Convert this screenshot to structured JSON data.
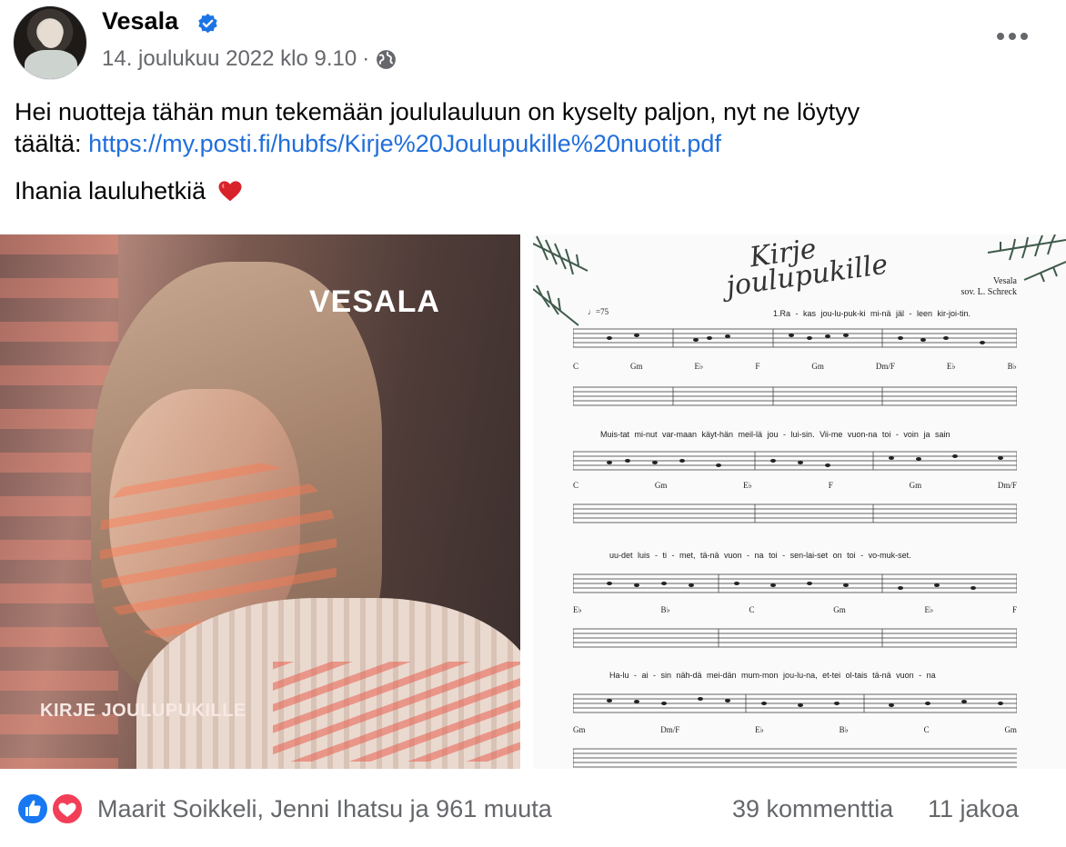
{
  "post": {
    "author": "Vesala",
    "timestamp": "14. joulukuu 2022 klo 9.10",
    "separator": "·",
    "text_line1": "Hei nuotteja tähän mun tekemään joululauluun on kyselty paljon, nyt ne löytyy",
    "text_line2_prefix": "täältä: ",
    "link": "https://my.posti.fi/hubfs/Kirje%20Joulupukille%20nuotit.pdf",
    "text_line3": "Ihania lauluhetkiä"
  },
  "cover": {
    "artist": "VESALA",
    "title": "KIRJE JOULUPUKILLE"
  },
  "sheet_music": {
    "title_line1": "Kirje",
    "title_line2": "joulupukille",
    "composer_line1": "Vesala",
    "composer_line2": "sov. L. Schreck",
    "tempo": "♩=75",
    "systems": [
      {
        "lyric": "1.Ra - kas jou-lu-puk-ki mi-nä jäl - leen kir-joi-tin.",
        "chords": [
          "C",
          "Gm",
          "E♭",
          "F",
          "Gm",
          "Dm/F",
          "E♭",
          "B♭"
        ]
      },
      {
        "lyric": "Muis-tat mi-nut var-maan käyt-hän meil-lä jou - lui-sin.      Vii-me vuon-na toi - voin    ja sain",
        "chords": [
          "C",
          "Gm",
          "E♭",
          "F",
          "Gm",
          "Dm/F"
        ]
      },
      {
        "lyric": "uu-det luis - ti - met,            tä-nä  vuon - na  toi  -  sen-lai-set    on  toi - vo-muk-set.",
        "chords": [
          "E♭",
          "B♭",
          "C",
          "Gm",
          "E♭",
          "F"
        ]
      },
      {
        "lyric": "Ha-lu - ai  -  sin näh-dä mei-dän mum-mon jou-lu-na,              et-tei  ol-tais tä-nä  vuon - na",
        "chords": [
          "Gm",
          "Dm/F",
          "E♭",
          "B♭",
          "C",
          "Gm"
        ]
      }
    ]
  },
  "engagement": {
    "reactors": "Maarit Soikkeli, Jenni Ihatsu ja 961 muuta",
    "comments": "39 kommenttia",
    "shares": "11 jakoa"
  },
  "colors": {
    "link": "#216fdb",
    "verified": "#1b74e4",
    "muted_text": "#65676b",
    "like_blue": "#1877f2",
    "love_red": "#f33e58"
  },
  "icons": [
    "verified-icon",
    "globe-icon",
    "more-icon",
    "heart-emoji",
    "like-reaction-icon",
    "love-reaction-icon"
  ]
}
